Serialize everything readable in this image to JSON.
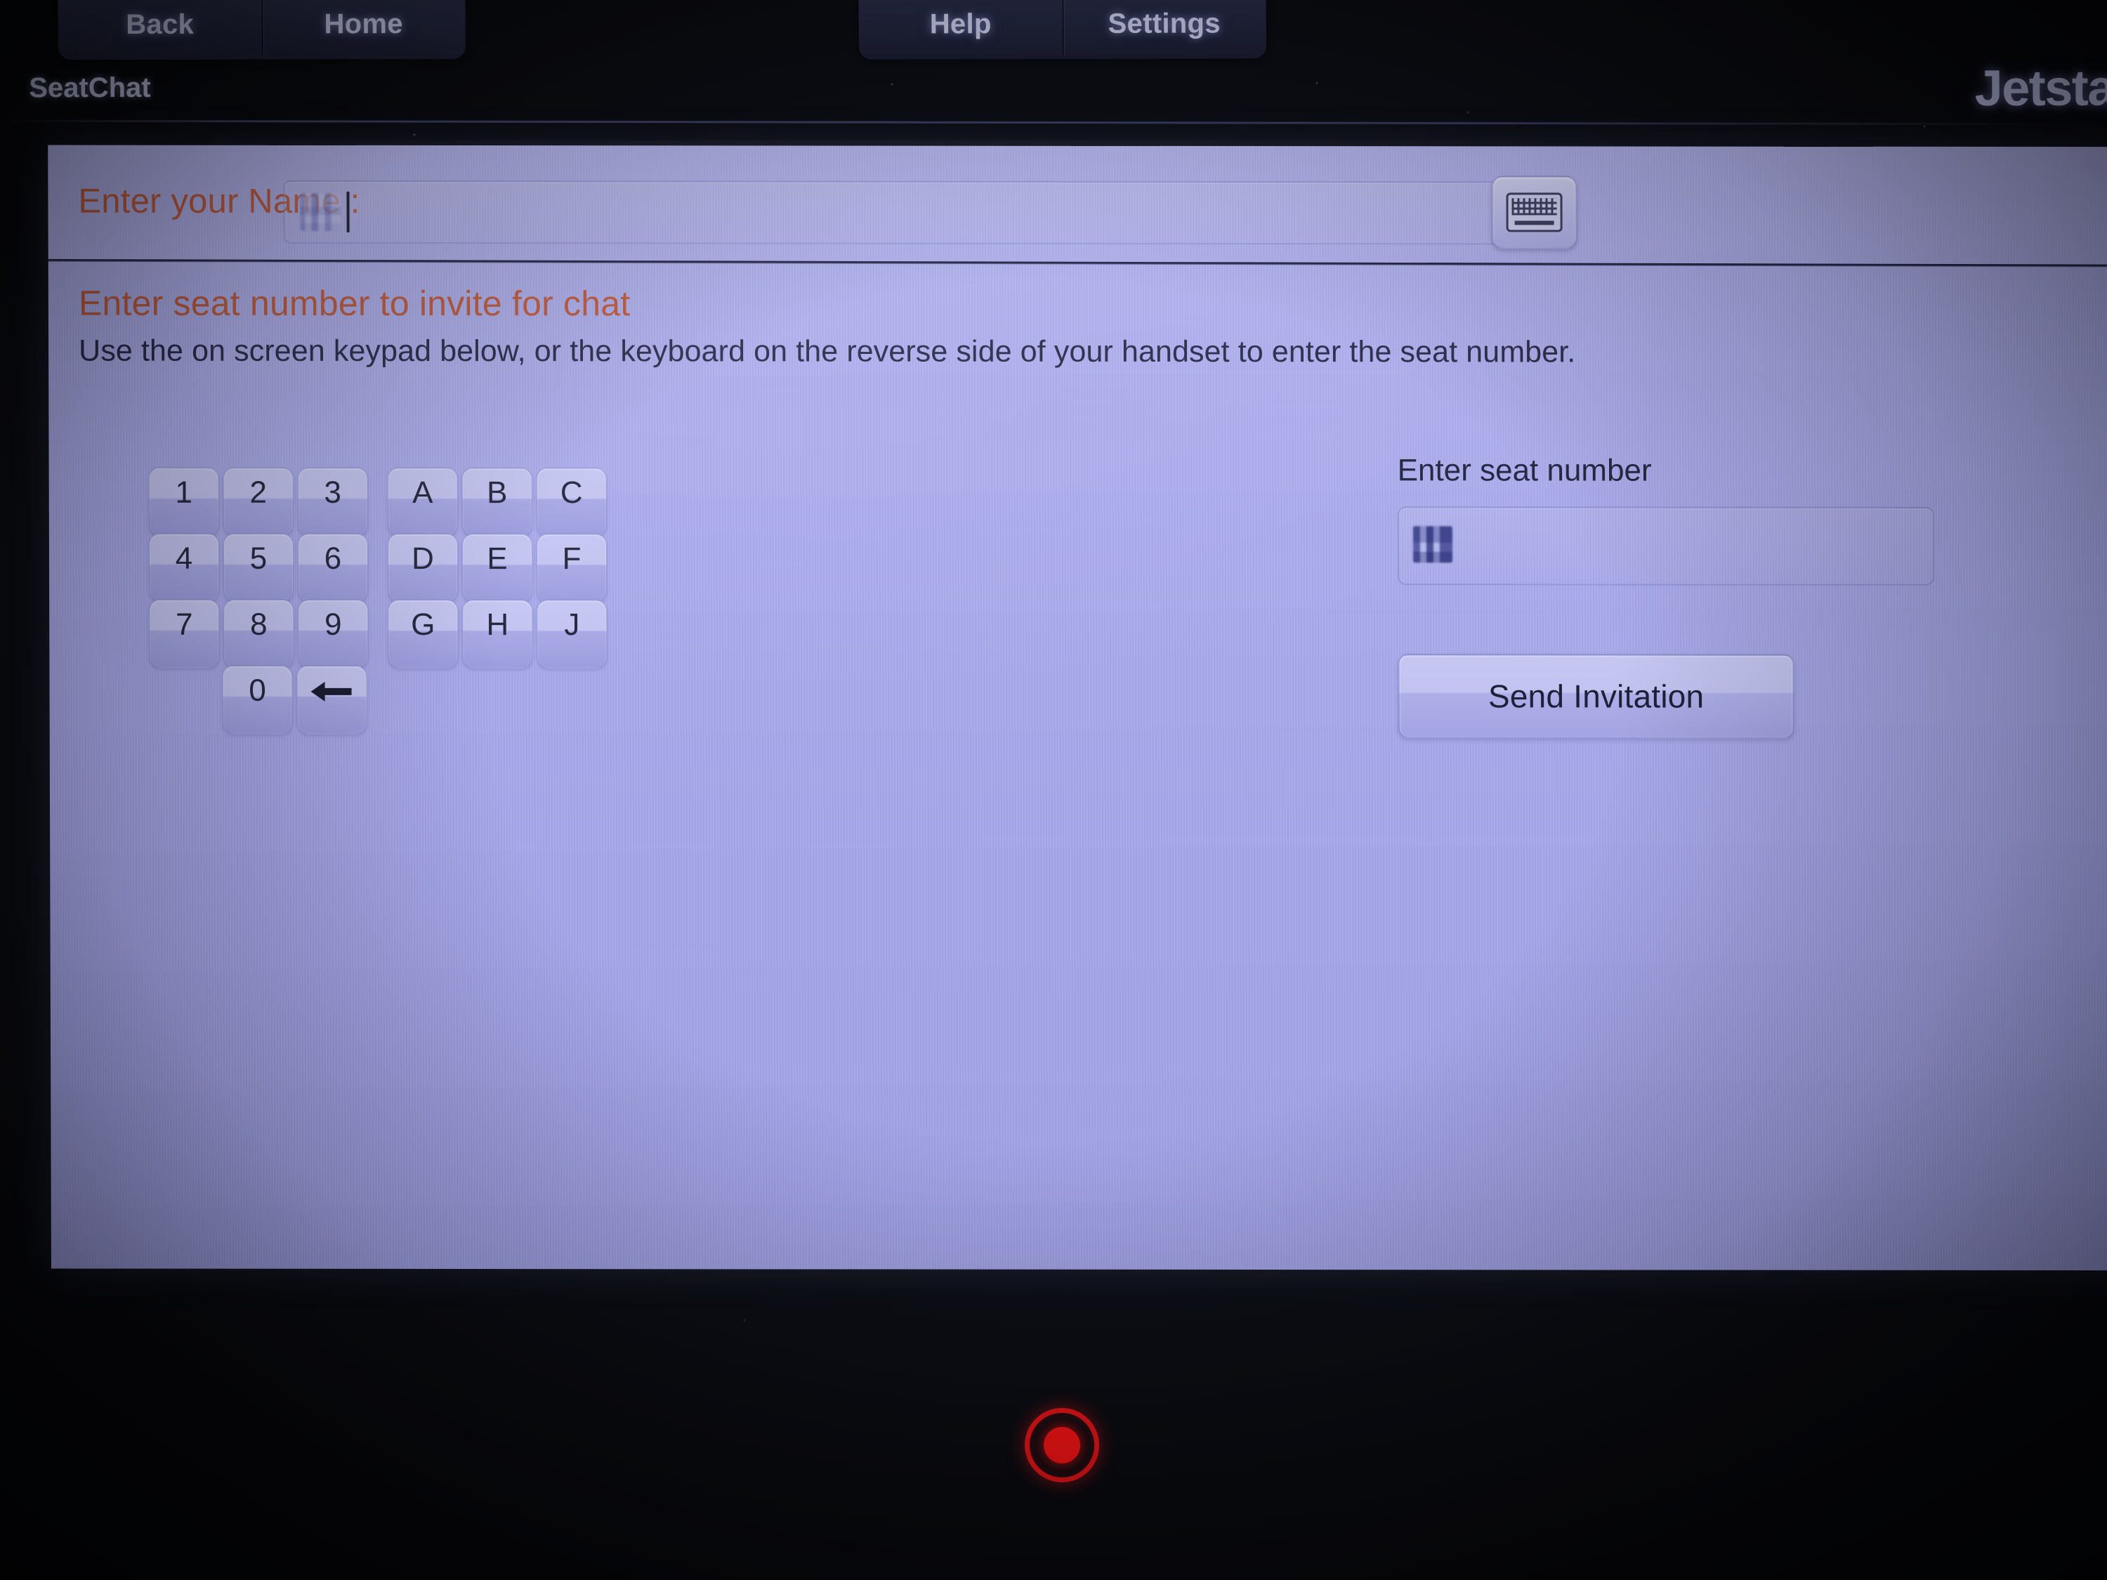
{
  "nav": {
    "left_group": [
      {
        "label": "Back",
        "name": "back"
      },
      {
        "label": "Home",
        "name": "home"
      }
    ],
    "right_group": [
      {
        "label": "Help",
        "name": "help"
      },
      {
        "label": "Settings",
        "name": "settings"
      }
    ]
  },
  "header": {
    "app_title": "SeatChat",
    "brand": "Jetstar"
  },
  "name_row": {
    "label": "Enter your Name :",
    "value": "",
    "value_state": "redacted",
    "keyboard_button_icon": "keyboard-icon"
  },
  "seat_section": {
    "heading": "Enter seat number to invite for chat",
    "instruction": "Use the on screen keypad below, or the keyboard on the reverse side of your handset to enter the seat number."
  },
  "keypad": {
    "rows": [
      [
        "1",
        "2",
        "3",
        "A",
        "B",
        "C"
      ],
      [
        "4",
        "5",
        "6",
        "D",
        "E",
        "F"
      ],
      [
        "7",
        "8",
        "9",
        "G",
        "H",
        "J"
      ]
    ],
    "bottom_row": [
      "0"
    ],
    "backspace_icon": "backspace-arrow-icon"
  },
  "seat_entry": {
    "label": "Enter seat number",
    "value": "",
    "value_state": "redacted",
    "send_button": "Send Invitation"
  },
  "hardware": {
    "record_indicator": "record-indicator"
  },
  "colors": {
    "panel_bg": "#a9aaec",
    "heading_accent": "#bf5c40",
    "body_text": "#2b2d4c",
    "nav_text": "#c9cbe8",
    "record_red": "#fb1416",
    "bezel": "#0a0c12"
  }
}
